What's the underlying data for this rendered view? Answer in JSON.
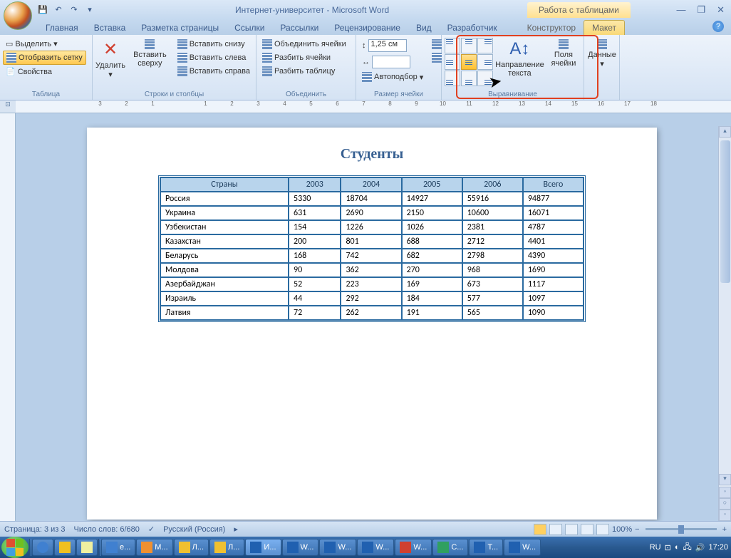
{
  "titlebar": {
    "title": "Интернет-университет - Microsoft Word",
    "table_tools": "Работа с таблицами"
  },
  "tabs": {
    "items": [
      "Главная",
      "Вставка",
      "Разметка страницы",
      "Ссылки",
      "Рассылки",
      "Рецензирование",
      "Вид",
      "Разработчик"
    ],
    "context": [
      "Конструктор",
      "Макет"
    ],
    "active": "Макет"
  },
  "ribbon": {
    "table_group": {
      "label": "Таблица",
      "select": "Выделить",
      "show_grid": "Отобразить сетку",
      "properties": "Свойства"
    },
    "rows_cols_group": {
      "label": "Строки и столбцы",
      "delete": "Удалить",
      "insert_above": "Вставить сверху",
      "insert_below": "Вставить снизу",
      "insert_left": "Вставить слева",
      "insert_right": "Вставить справа"
    },
    "merge_group": {
      "label": "Объединить",
      "merge": "Объединить ячейки",
      "split": "Разбить ячейки",
      "split_table": "Разбить таблицу"
    },
    "size_group": {
      "label": "Размер ячейки",
      "height": "1,25 см",
      "width": "",
      "autofit": "Автоподбор"
    },
    "align_group": {
      "label": "Выравнивание",
      "direction": "Направление текста",
      "margins": "Поля ячейки"
    },
    "data_group": {
      "label": "Данные",
      "data": "Данные"
    }
  },
  "ruler_marks": [
    "3",
    "2",
    "1",
    "",
    "1",
    "2",
    "3",
    "4",
    "5",
    "6",
    "7",
    "8",
    "9",
    "10",
    "11",
    "12",
    "13",
    "14",
    "15",
    "16",
    "17",
    "18"
  ],
  "document": {
    "title": "Студенты",
    "headers": [
      "Страны",
      "2003",
      "2004",
      "2005",
      "2006",
      "Всего"
    ],
    "rows": [
      [
        "Россия",
        "5330",
        "18704",
        "14927",
        "55916",
        "94877"
      ],
      [
        "Украина",
        "631",
        "2690",
        "2150",
        "10600",
        "16071"
      ],
      [
        "Узбекистан",
        "154",
        "1226",
        "1026",
        "2381",
        "4787"
      ],
      [
        "Казахстан",
        "200",
        "801",
        "688",
        "2712",
        "4401"
      ],
      [
        "Беларусь",
        "168",
        "742",
        "682",
        "2798",
        "4390"
      ],
      [
        "Молдова",
        "90",
        "362",
        "270",
        "968",
        "1690"
      ],
      [
        "Азербайджан",
        "52",
        "223",
        "169",
        "673",
        "1117"
      ],
      [
        "Израиль",
        "44",
        "292",
        "184",
        "577",
        "1097"
      ],
      [
        "Латвия",
        "72",
        "262",
        "191",
        "565",
        "1090"
      ]
    ]
  },
  "statusbar": {
    "page": "Страница: 3 из 3",
    "words": "Число слов: 6/680",
    "lang": "Русский (Россия)",
    "zoom": "100%"
  },
  "taskbar": {
    "items": [
      "e...",
      "M...",
      "Л...",
      "Л...",
      "И...",
      "W...",
      "W...",
      "W...",
      "W...",
      "С...",
      "T...",
      "W..."
    ],
    "lang": "RU",
    "time": "17:20"
  }
}
